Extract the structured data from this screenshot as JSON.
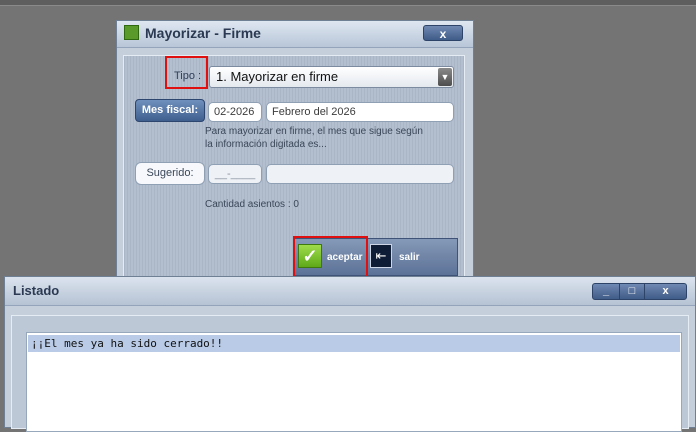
{
  "dialog": {
    "title": "Mayorizar - Firme",
    "close_label": "x",
    "tipo_label": "Tipo :",
    "tipo_value": "1. Mayorizar en firme",
    "mes_fiscal_button": "Mes fiscal:",
    "mes_code": "02-2026",
    "mes_name": "Febrero del 2026",
    "hint_line1": "Para mayorizar en firme, el mes que sigue según",
    "hint_line2": "la información digitada es...",
    "sugerido_button": "Sugerido:",
    "sugerido_code": "__-____",
    "sugerido_name": "",
    "cantidad_text": "Cantidad asientos : 0",
    "accept_label": "aceptar",
    "exit_label": "salir",
    "icons": [
      "chart-icon",
      "check-icon",
      "exit-icon",
      "chevron-down-icon"
    ]
  },
  "listado": {
    "title": "Listado",
    "minimize_label": "_",
    "maximize_label": "□",
    "close_label": "x",
    "rows": [
      "¡¡El mes ya ha sido cerrado!!"
    ]
  },
  "colors": {
    "background": "#747474",
    "title_bar": "#c8d3e2",
    "accent_button": "#4b6a99",
    "highlight_red": "#e01010",
    "selected_row": "#b9cbe6"
  }
}
